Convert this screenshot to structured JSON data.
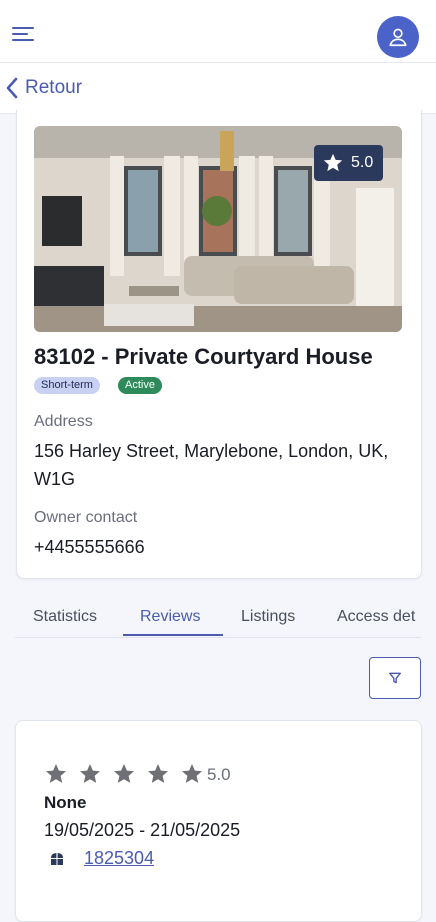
{
  "header": {
    "menu_icon": "menu-icon",
    "avatar_icon": "user-icon",
    "accent": "#4b62c9"
  },
  "nav": {
    "back_label": "Retour"
  },
  "property": {
    "rating": "5.0",
    "title": "83102 - Private Courtyard House",
    "badges": [
      "Short-term",
      "Active"
    ],
    "address_label": "Address",
    "address_value": "156 Harley Street, Marylebone, London, UK, W1G",
    "owner_label": "Owner contact",
    "owner_value": "+4455555666"
  },
  "tabs": [
    "Statistics",
    "Reviews",
    "Listings",
    "Access det"
  ],
  "active_tab": "Reviews",
  "filter": {
    "icon": "filter-icon"
  },
  "review": {
    "stars": 5,
    "rating": "5.0",
    "name": "None",
    "dates": "19/05/2025 - 21/05/2025",
    "booking_id": "1825304"
  }
}
